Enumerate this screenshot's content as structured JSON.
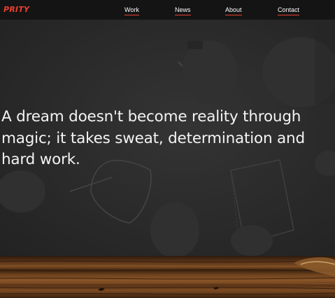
{
  "brand": {
    "logo_text": "PRITY",
    "accent_color": "#e8402f"
  },
  "nav": {
    "items": [
      {
        "label": "Work"
      },
      {
        "label": "News"
      },
      {
        "label": "About"
      },
      {
        "label": "Contact"
      }
    ]
  },
  "hero": {
    "quote": "A dream doesn't become reality through magic; it takes sweat, determination and hard work."
  }
}
